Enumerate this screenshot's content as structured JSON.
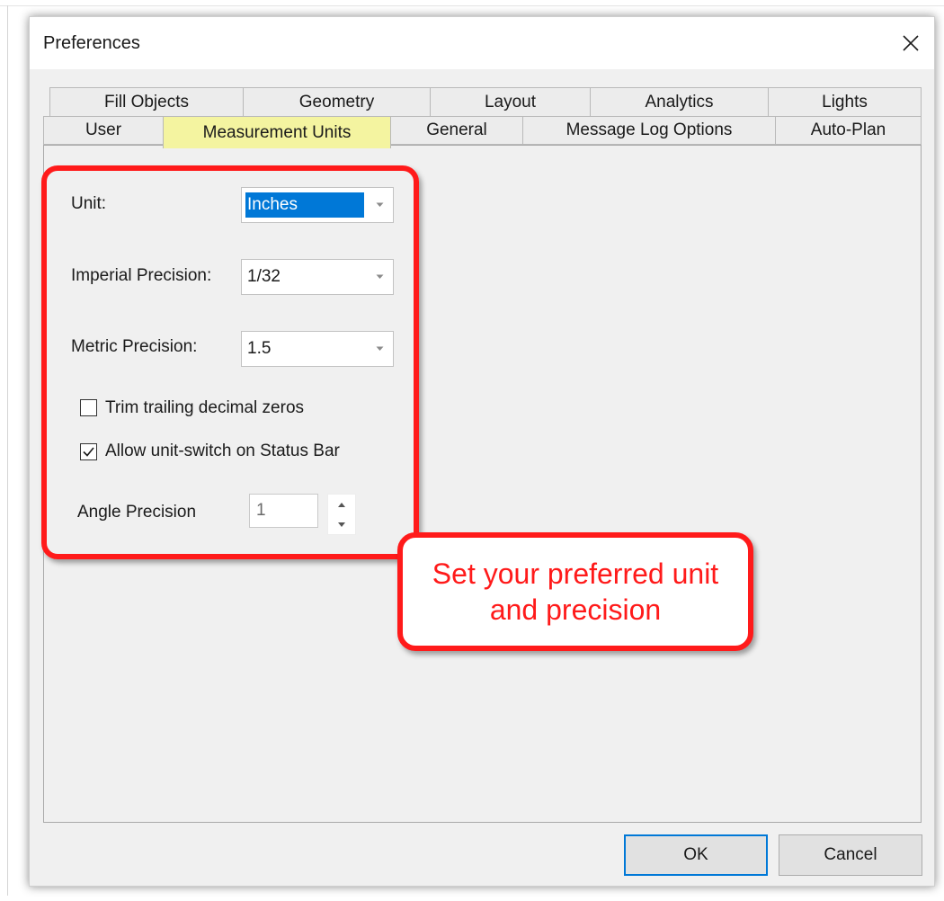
{
  "dialog": {
    "title": "Preferences",
    "close_icon": "close-icon"
  },
  "tabs": {
    "row1": [
      "Fill Objects",
      "Geometry",
      "Layout",
      "Analytics",
      "Lights"
    ],
    "row2": [
      "User",
      "Measurement Units",
      "General",
      "Message Log Options",
      "Auto-Plan"
    ],
    "active": "Measurement Units"
  },
  "settings": {
    "unit": {
      "label": "Unit:",
      "value": "Inches"
    },
    "imperial_precision": {
      "label": "Imperial Precision:",
      "value": "1/32"
    },
    "metric_precision": {
      "label": "Metric Precision:",
      "value": "1.5"
    },
    "trim_zeros": {
      "label": "Trim trailing decimal zeros",
      "checked": false
    },
    "allow_unit_switch": {
      "label": "Allow unit-switch on Status Bar",
      "checked": true
    },
    "angle_precision": {
      "label": "Angle Precision",
      "value": "1"
    }
  },
  "callout": {
    "text": "Set your preferred unit and precision"
  },
  "buttons": {
    "ok": "OK",
    "cancel": "Cancel"
  },
  "colors": {
    "active_tab": "#f4f4a0",
    "highlight": "#ff1a1a",
    "selection": "#0078d7"
  }
}
